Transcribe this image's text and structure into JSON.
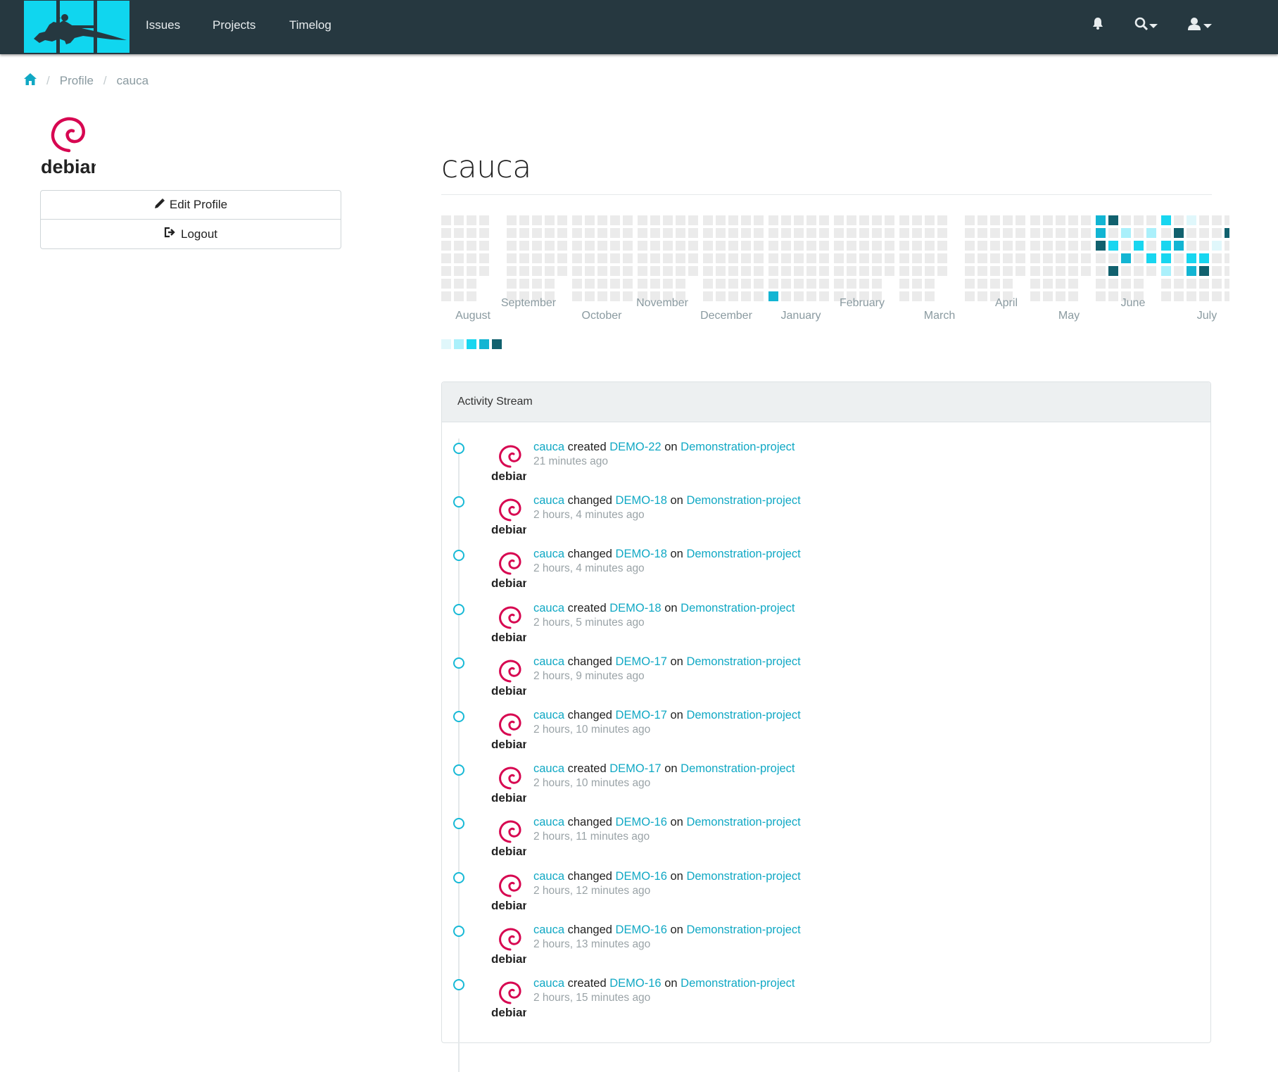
{
  "nav": {
    "links": [
      "Issues",
      "Projects",
      "Timelog"
    ],
    "icons": [
      "bell-icon",
      "search-icon",
      "user-icon"
    ]
  },
  "breadcrumb": [
    "Profile",
    "cauca"
  ],
  "sidebar": {
    "avatar_text": "debian",
    "edit_label": "Edit Profile",
    "logout_label": "Logout"
  },
  "profile": {
    "username": "cauca",
    "months": [
      "August",
      "September",
      "October",
      "November",
      "December",
      "January",
      "February",
      "March",
      "April",
      "May",
      "June",
      "July"
    ]
  },
  "colors": {
    "accent": "#10a8c4",
    "nav_bg": "#263840",
    "logo_bg": "#10d6ef",
    "heat_levels": [
      "#ebebeb",
      "#e0f7fb",
      "#aaf0fb",
      "#18d6f0",
      "#12b5d3",
      "#11616e"
    ]
  },
  "activity": {
    "title": "Activity Stream",
    "items": [
      {
        "user": "cauca",
        "verb": "created",
        "issue": "DEMO-22",
        "on": "on",
        "project": "Demonstration-project",
        "time": "21 minutes ago"
      },
      {
        "user": "cauca",
        "verb": "changed",
        "issue": "DEMO-18",
        "on": "on",
        "project": "Demonstration-project",
        "time": "2 hours, 4 minutes ago"
      },
      {
        "user": "cauca",
        "verb": "changed",
        "issue": "DEMO-18",
        "on": "on",
        "project": "Demonstration-project",
        "time": "2 hours, 4 minutes ago"
      },
      {
        "user": "cauca",
        "verb": "created",
        "issue": "DEMO-18",
        "on": "on",
        "project": "Demonstration-project",
        "time": "2 hours, 5 minutes ago"
      },
      {
        "user": "cauca",
        "verb": "changed",
        "issue": "DEMO-17",
        "on": "on",
        "project": "Demonstration-project",
        "time": "2 hours, 9 minutes ago"
      },
      {
        "user": "cauca",
        "verb": "changed",
        "issue": "DEMO-17",
        "on": "on",
        "project": "Demonstration-project",
        "time": "2 hours, 10 minutes ago"
      },
      {
        "user": "cauca",
        "verb": "created",
        "issue": "DEMO-17",
        "on": "on",
        "project": "Demonstration-project",
        "time": "2 hours, 10 minutes ago"
      },
      {
        "user": "cauca",
        "verb": "changed",
        "issue": "DEMO-16",
        "on": "on",
        "project": "Demonstration-project",
        "time": "2 hours, 11 minutes ago"
      },
      {
        "user": "cauca",
        "verb": "changed",
        "issue": "DEMO-16",
        "on": "on",
        "project": "Demonstration-project",
        "time": "2 hours, 12 minutes ago"
      },
      {
        "user": "cauca",
        "verb": "changed",
        "issue": "DEMO-16",
        "on": "on",
        "project": "Demonstration-project",
        "time": "2 hours, 13 minutes ago"
      },
      {
        "user": "cauca",
        "verb": "created",
        "issue": "DEMO-16",
        "on": "on",
        "project": "Demonstration-project",
        "time": "2 hours, 15 minutes ago"
      }
    ]
  }
}
